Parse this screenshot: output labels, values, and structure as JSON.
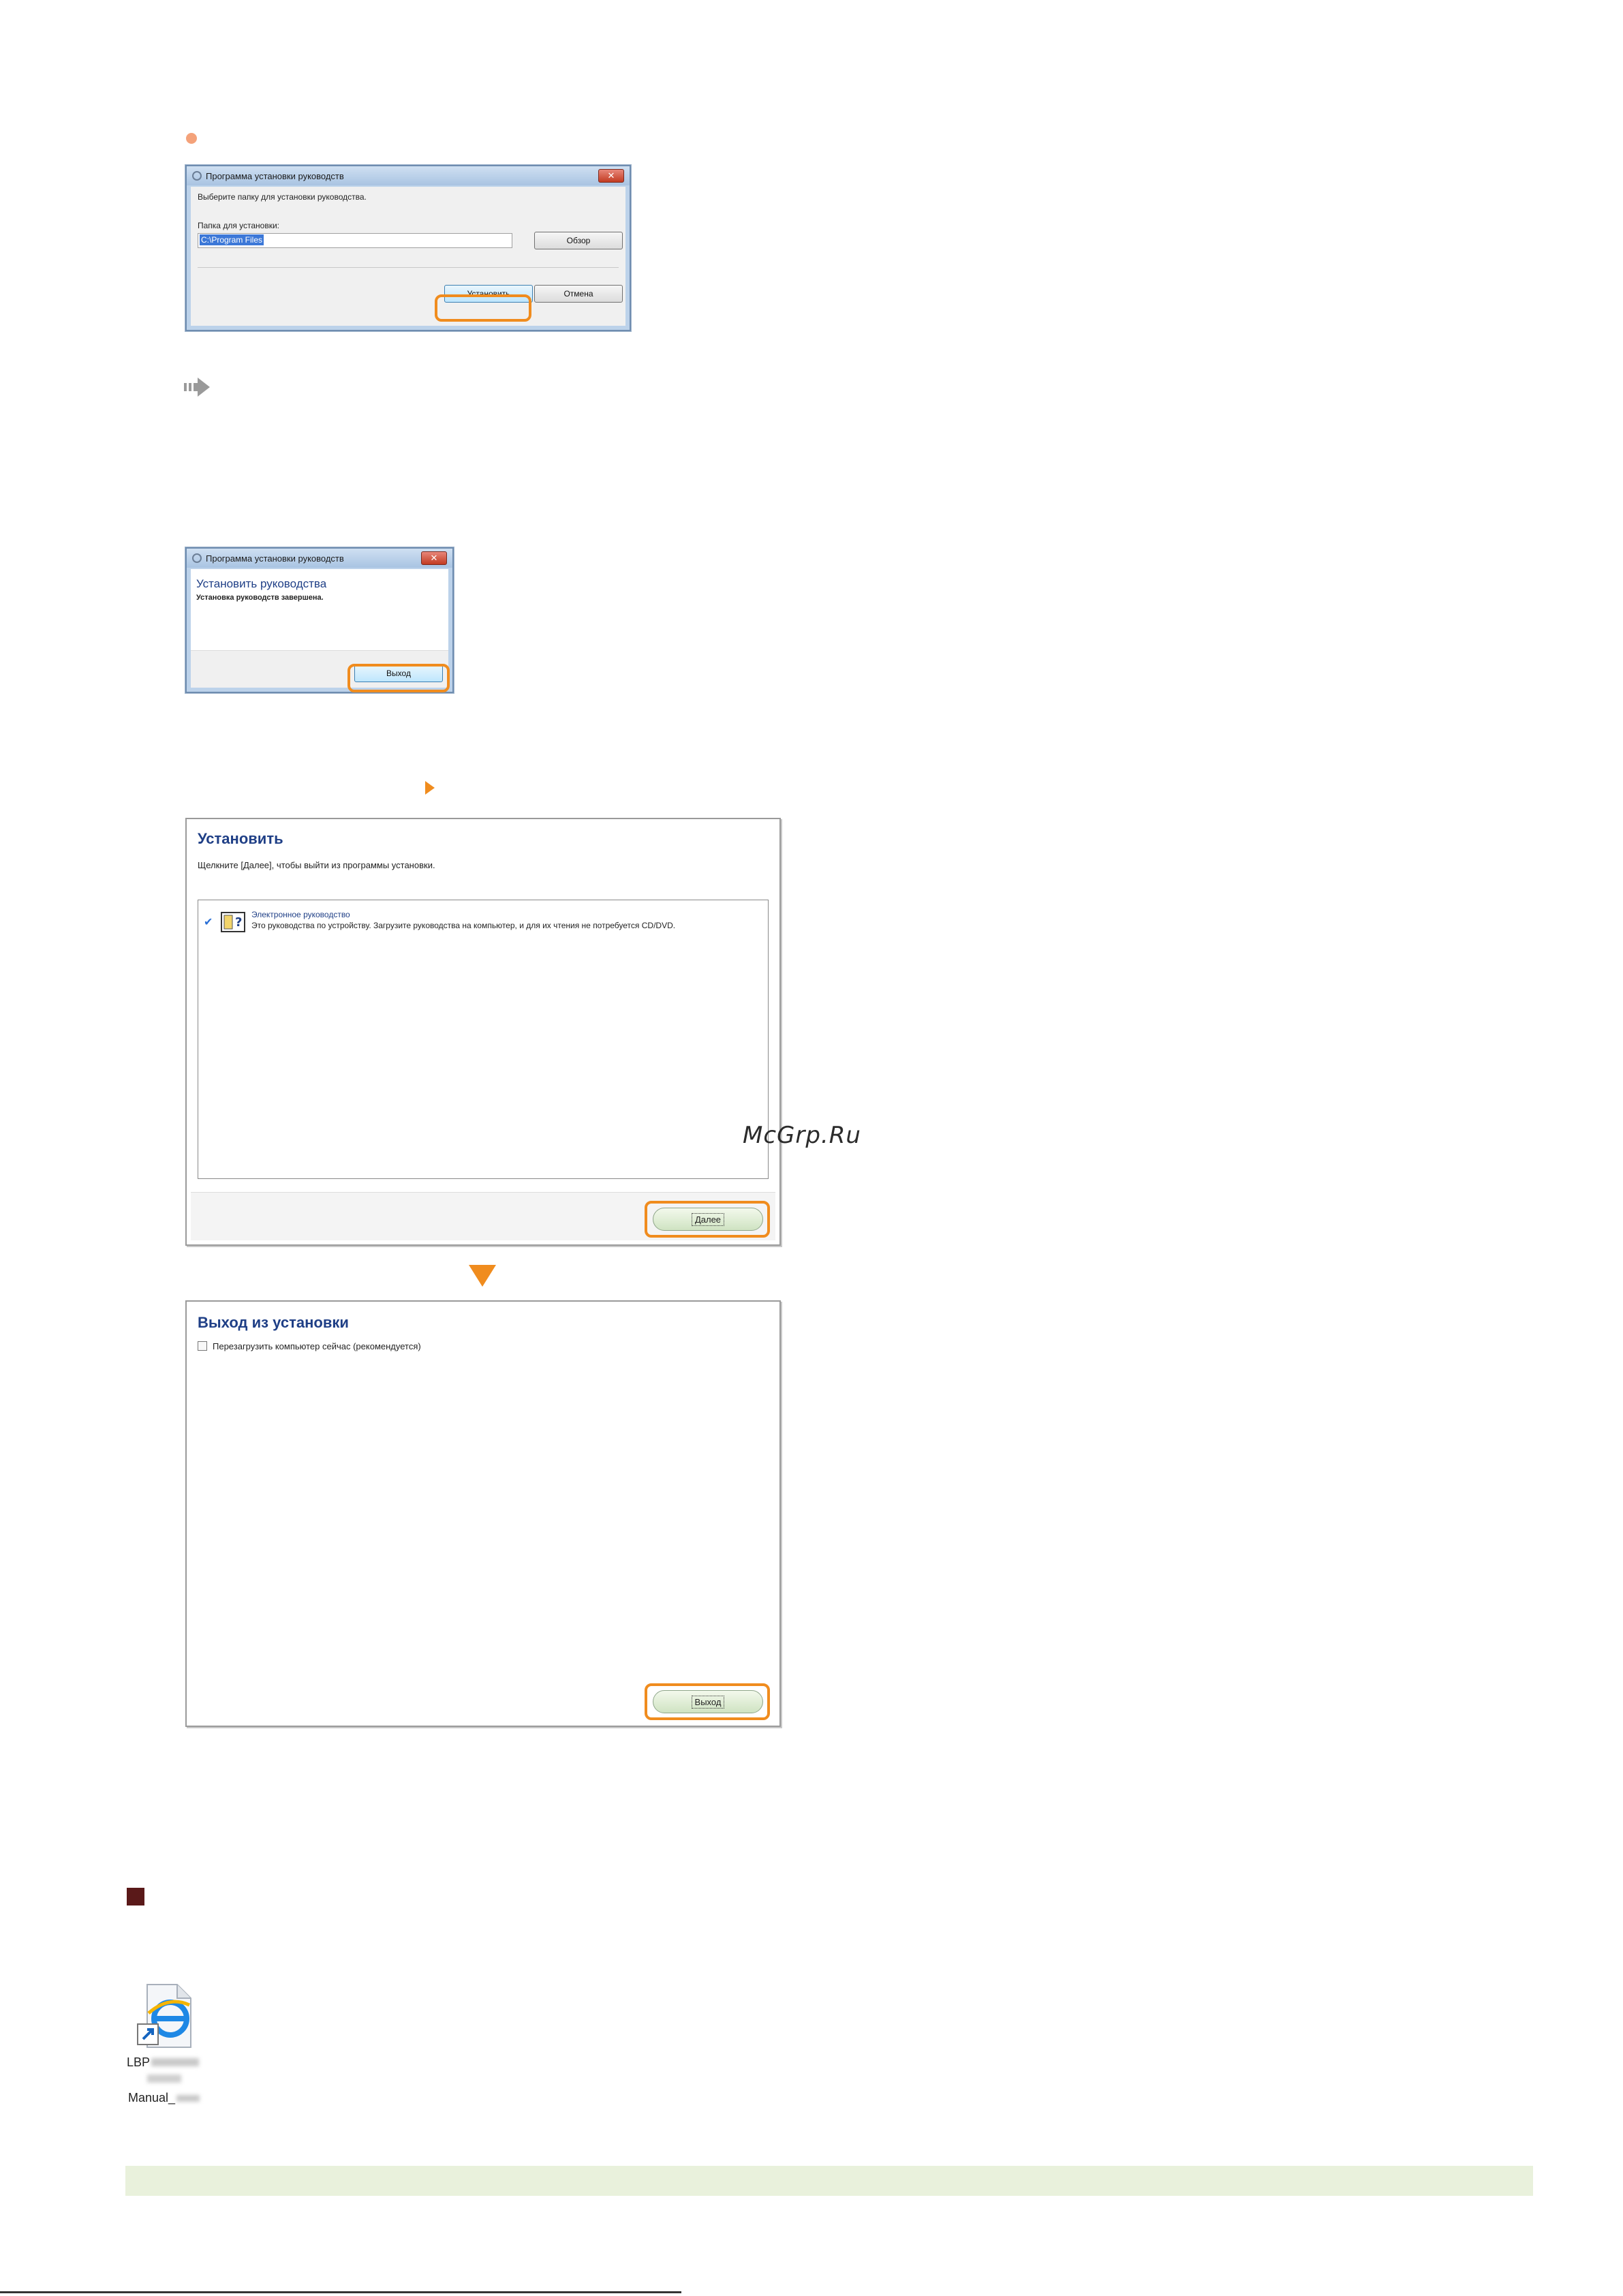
{
  "dialog1": {
    "title": "Программа установки руководств",
    "prompt": "Выберите папку для установки руководства.",
    "field_label": "Папка для установки:",
    "field_value": "C:\\Program Files",
    "browse_label": "Обзор",
    "install_label": "Установить",
    "cancel_label": "Отмена",
    "close_glyph": "✕"
  },
  "dialog2": {
    "title": "Программа установки руководств",
    "heading": "Установить руководства",
    "message": "Установка руководств завершена.",
    "exit_label": "Выход",
    "close_glyph": "✕"
  },
  "panel1": {
    "title": "Установить",
    "subtitle": "Щелкните [Далее], чтобы выйти из программы установки.",
    "item_name": "Электронное руководство",
    "item_desc": "Это руководства по устройству. Загрузите руководства на компьютер, и для их чтения не потребуется CD/DVD.",
    "check_glyph": "✔",
    "next_label": "Далее"
  },
  "panel2": {
    "title": "Выход из установки",
    "checkbox_label": "Перезагрузить компьютер сейчас (рекомендуется)",
    "exit_label": "Выход"
  },
  "watermark": "McGrp.Ru",
  "shortcut": {
    "line1": "LBP",
    "line2": "Manual_"
  },
  "colors": {
    "accent_orange": "#f08c1e",
    "dialog_blue": "#1f3f86",
    "section_marker": "#5a1919",
    "note_bar": "#e9f1dc"
  }
}
